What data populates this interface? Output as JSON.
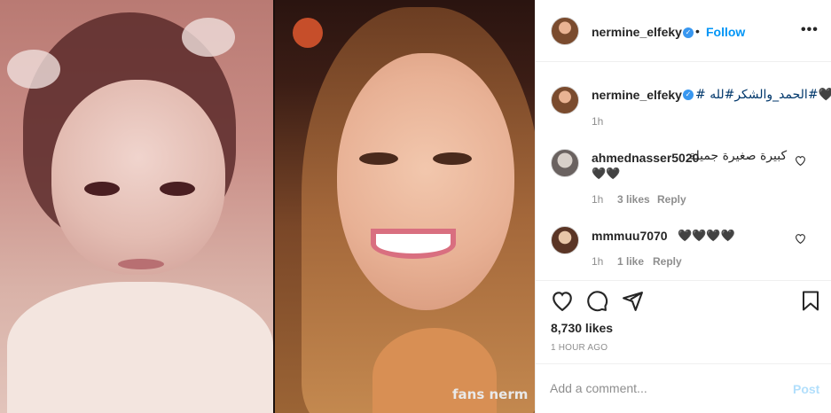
{
  "post": {
    "watermark": "fans nerm"
  },
  "header": {
    "username": "nermine_elfeky",
    "verified_glyph": "✓",
    "dot": "•",
    "follow_label": "Follow",
    "more_label": "•••"
  },
  "caption": {
    "username": "nermine_elfeky",
    "text": "# الحمد_والشكر#لله#🖤#",
    "time": "1h"
  },
  "comments": [
    {
      "username": "ahmednasser5020",
      "text": "كبيرة صغيرة جميلة",
      "extra": "🖤🖤",
      "time": "1h",
      "likes": "3 likes",
      "reply": "Reply"
    },
    {
      "username": "mmmuu7070",
      "text": "🖤🖤🖤🖤",
      "time": "1h",
      "likes": "1 like",
      "reply": "Reply"
    }
  ],
  "actions": {
    "icons": [
      "heart-icon",
      "comment-icon",
      "share-icon",
      "bookmark-icon"
    ]
  },
  "likes": "8,730 likes",
  "posted": "1 HOUR AGO",
  "add_comment": {
    "placeholder": "Add a comment...",
    "post_label": "Post"
  },
  "colors": {
    "link": "#0095f6",
    "verified": "#3897f0",
    "muted": "#8e8e8e",
    "post_disabled": "#b2dffc"
  }
}
